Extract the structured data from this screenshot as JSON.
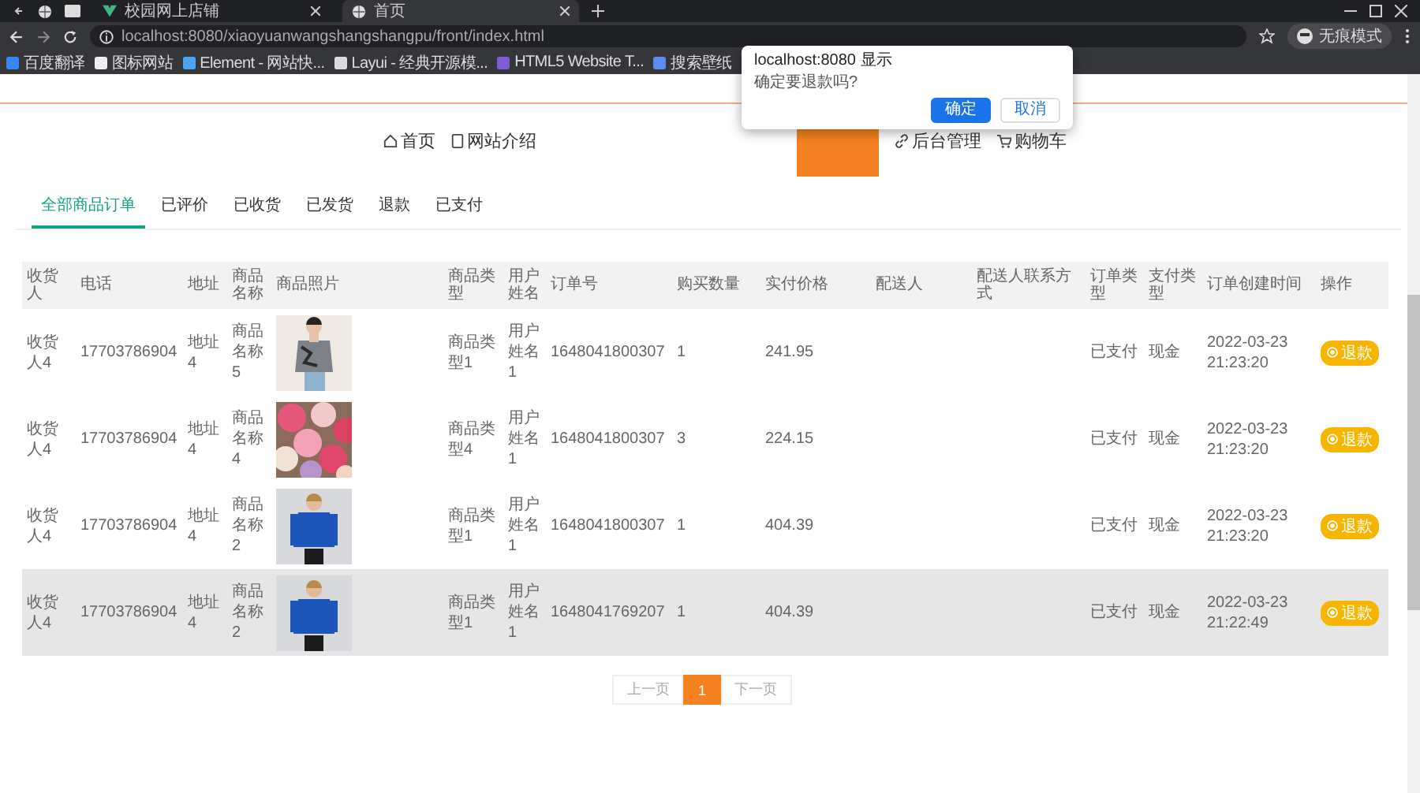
{
  "browser": {
    "tabs": [
      {
        "title": "校园网上店铺",
        "selected": false
      },
      {
        "title": "首页",
        "selected": true
      }
    ],
    "url": "localhost:8080/xiaoyuanwangshangshangpu/front/index.html",
    "profile_label": "无痕模式",
    "bookmarks": [
      "百度翻译",
      "图标网站",
      "Element - 网站快...",
      "Layui - 经典开源模...",
      "HTML5 Website T...",
      "搜索壁纸"
    ]
  },
  "dialog": {
    "title": "localhost:8080 显示",
    "message": "确定要退款吗?",
    "buttons": [
      {
        "label": "确定",
        "kind": "primary"
      },
      {
        "label": "取消",
        "kind": "secondary"
      }
    ]
  },
  "nav": [
    {
      "label": "首页",
      "selected": false
    },
    {
      "label": "网站介绍",
      "selected": false
    },
    {
      "selected": true
    },
    {
      "label": "后台管理",
      "selected": false
    },
    {
      "label": "购物车",
      "selected": false
    }
  ],
  "order_tabs": [
    {
      "label": "全部商品订单",
      "selected": true
    },
    {
      "label": "已评价",
      "selected": false
    },
    {
      "label": "已收货",
      "selected": false
    },
    {
      "label": "已发货",
      "selected": false
    },
    {
      "label": "退款",
      "selected": false
    },
    {
      "label": "已支付",
      "selected": false
    }
  ],
  "table": {
    "columns": [
      "收货人",
      "电话",
      "地址",
      "商品名称",
      "商品照片",
      "商品类型",
      "用户姓名",
      "订单号",
      "购买数量",
      "实付价格",
      "配送人",
      "配送人联系方式",
      "订单类型",
      "支付类型",
      "订单创建时间",
      "操作"
    ],
    "rows": [
      {
        "receiver": "收货人4",
        "phone": "17703786904",
        "address": "地址4",
        "product_name": "商品名称5",
        "product_type": "商品类型1",
        "user_name": "用户姓名1",
        "order_no": "1648041800307",
        "quantity": "1",
        "paid": "241.95",
        "order_status": "已支付",
        "payment": "现金",
        "created": "2022-03-23 21:23:20",
        "action": "退款",
        "highlighted": false
      },
      {
        "receiver": "收货人4",
        "phone": "17703786904",
        "address": "地址4",
        "product_name": "商品名称4",
        "product_type": "商品类型4",
        "user_name": "用户姓名1",
        "order_no": "1648041800307",
        "quantity": "3",
        "paid": "224.15",
        "order_status": "已支付",
        "payment": "现金",
        "created": "2022-03-23 21:23:20",
        "action": "退款",
        "highlighted": false
      },
      {
        "receiver": "收货人4",
        "phone": "17703786904",
        "address": "地址4",
        "product_name": "商品名称2",
        "product_type": "商品类型1",
        "user_name": "用户姓名1",
        "order_no": "1648041800307",
        "quantity": "1",
        "paid": "404.39",
        "order_status": "已支付",
        "payment": "现金",
        "created": "2022-03-23 21:23:20",
        "action": "退款",
        "highlighted": false
      },
      {
        "receiver": "收货人4",
        "phone": "17703786904",
        "address": "地址4",
        "product_name": "商品名称2",
        "product_type": "商品类型1",
        "user_name": "用户姓名1",
        "order_no": "1648041769207",
        "quantity": "1",
        "paid": "404.39",
        "order_status": "已支付",
        "payment": "现金",
        "created": "2022-03-23 21:22:49",
        "action": "退款",
        "highlighted": true
      }
    ]
  },
  "pagination": [
    {
      "label": "上一页",
      "selected": false
    },
    {
      "label": "1",
      "selected": true
    },
    {
      "label": "下一页",
      "selected": false
    }
  ]
}
